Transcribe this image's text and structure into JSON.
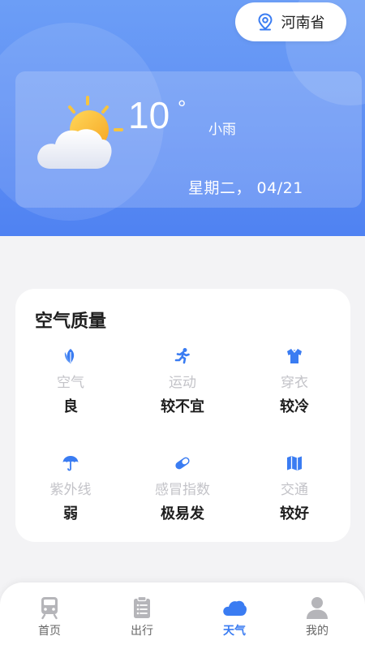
{
  "location": {
    "name": "河南省",
    "icon": "location-pin-icon"
  },
  "weather": {
    "temperature": "10",
    "degree_symbol": "°",
    "condition": "小雨",
    "date": "星期二， 04/21",
    "icon": "sun-behind-cloud-icon"
  },
  "air_quality": {
    "title": "空气质量",
    "items": [
      {
        "label": "空气",
        "value": "良",
        "icon": "leaf-icon"
      },
      {
        "label": "运动",
        "value": "较不宜",
        "icon": "running-icon"
      },
      {
        "label": "穿衣",
        "value": "较冷",
        "icon": "shirt-icon"
      },
      {
        "label": "紫外线",
        "value": "弱",
        "icon": "umbrella-icon"
      },
      {
        "label": "感冒指数",
        "value": "极易发",
        "icon": "pill-icon"
      },
      {
        "label": "交通",
        "value": "较好",
        "icon": "map-icon"
      }
    ]
  },
  "nav": {
    "active_index": 2,
    "items": [
      {
        "label": "首页",
        "icon": "train-icon"
      },
      {
        "label": "出行",
        "icon": "clipboard-list-icon"
      },
      {
        "label": "天气",
        "icon": "cloud-icon"
      },
      {
        "label": "我的",
        "icon": "user-icon"
      }
    ]
  },
  "colors": {
    "accent": "#3a7cf2",
    "hero_top": "#6c9ef6",
    "hero_bottom": "#4f82f2",
    "muted_label": "#c3c3c8"
  }
}
